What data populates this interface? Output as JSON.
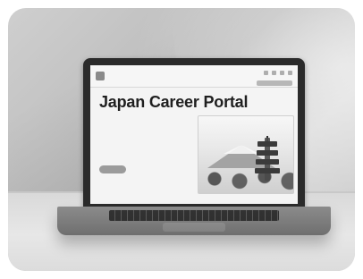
{
  "screen": {
    "site_header": {
      "logo_text_lines": [
        "",
        ""
      ],
      "nav_items": [
        "",
        "",
        "",
        "",
        "",
        "",
        ""
      ],
      "icons": [
        "dot-icon",
        "dot-icon",
        "dot-icon",
        "dot-icon"
      ]
    },
    "hero": {
      "title": "Japan Career Portal",
      "paragraphs": [
        "",
        ""
      ],
      "button_label": ""
    }
  }
}
